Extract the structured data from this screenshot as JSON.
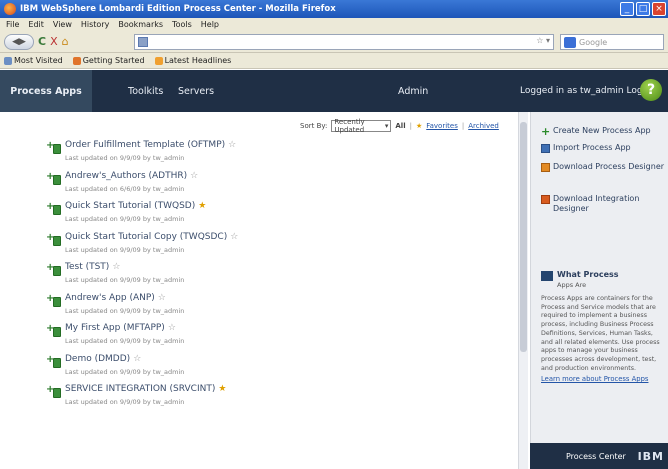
{
  "window": {
    "title": "IBM WebSphere Lombardi Edition Process Center - Mozilla Firefox",
    "controls": [
      "_",
      "□",
      "×"
    ]
  },
  "menu": [
    "File",
    "Edit",
    "View",
    "History",
    "Bookmarks",
    "Tools",
    "Help"
  ],
  "nav": {
    "back": "◀",
    "forward": "▶",
    "reload": "C",
    "stop": "X",
    "home": "⌂",
    "url": "",
    "go": "☆ ▾",
    "search_engine": "Google",
    "search_placeholder": "Google"
  },
  "bookmarks": [
    "Most Visited",
    "Getting Started",
    "Latest Headlines"
  ],
  "header": {
    "tabs": [
      "Process Apps",
      "Toolkits",
      "Servers",
      "Admin"
    ],
    "active_tab": "Process Apps",
    "user_text": "Logged in as tw_admin  Logout",
    "help_icon": "?"
  },
  "sort": {
    "label": "Sort By:",
    "value": "Recently Updated",
    "view_all": "All",
    "favorites": "Favorites",
    "archived": "Archived",
    "separator": "|"
  },
  "process_apps": [
    {
      "name": "Order Fulfillment Template (OFTMP)",
      "favorite": false,
      "meta": "Last updated on 9/9/09 by tw_admin"
    },
    {
      "name": "Andrew's_Authors (ADTHR)",
      "favorite": false,
      "meta": "Last updated on 6/6/09 by tw_admin"
    },
    {
      "name": "Quick Start Tutorial (TWQSD)",
      "favorite": true,
      "meta": "Last updated on 9/9/09 by tw_admin"
    },
    {
      "name": "Quick Start Tutorial Copy (TWQSDC)",
      "favorite": false,
      "meta": "Last updated on 9/9/09 by tw_admin"
    },
    {
      "name": "Test (TST)",
      "favorite": false,
      "meta": "Last updated on 9/9/09 by tw_admin"
    },
    {
      "name": "Andrew's App (ANP)",
      "favorite": false,
      "meta": "Last updated on 9/9/09 by tw_admin"
    },
    {
      "name": "My First App (MFTAPP)",
      "favorite": false,
      "meta": "Last updated on 9/9/09 by tw_admin"
    },
    {
      "name": "Demo (DMDD)",
      "favorite": false,
      "meta": "Last updated on 9/9/09 by tw_admin"
    },
    {
      "name": "SERVICE INTEGRATION (SRVCINT)",
      "favorite": true,
      "meta": "Last updated on 9/9/09 by tw_admin"
    }
  ],
  "actions": [
    {
      "label": "Create New Process App",
      "icon": "plus-icon"
    },
    {
      "label": "Import Process App",
      "icon": "import-icon"
    },
    {
      "label": "Download Process Designer",
      "icon": "download-icon"
    },
    {
      "label": "Download Integration Designer",
      "icon": "download-icon"
    }
  ],
  "info_panel": {
    "title": "What Process",
    "subtitle": "Apps Are",
    "text": "Process Apps are containers for the Process and Service models that are required to implement a business process, including Business Process Definitions, Services, Human Tasks, and all related elements. Use process apps to manage your business processes across development, test, and production environments.",
    "link": "Learn more about Process Apps"
  },
  "footer": {
    "label": "Process Center",
    "brand": "IBM"
  }
}
